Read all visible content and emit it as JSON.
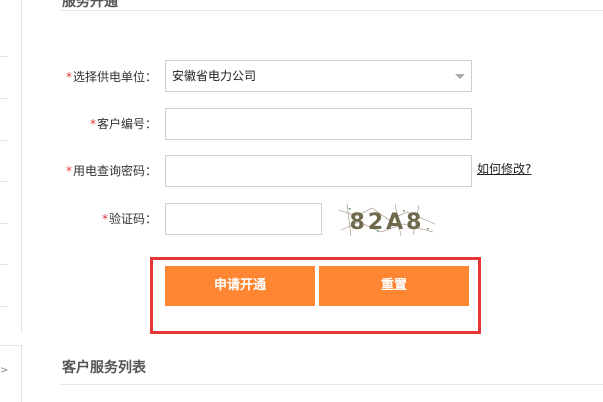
{
  "top_section": {
    "title_fragment": "服务开通"
  },
  "form": {
    "supplier": {
      "label": "选择供电单位：",
      "value": "安徽省电力公司"
    },
    "customer_no": {
      "label": "客户编号：",
      "value": ""
    },
    "query_password": {
      "label": "用电查询密码：",
      "value": "",
      "help_link": "如何修改?"
    },
    "captcha": {
      "label": "验证码：",
      "value": "",
      "image_text": "82A8"
    },
    "required_mark": "*"
  },
  "buttons": {
    "apply": "申请开通",
    "reset": "重置"
  },
  "section": {
    "title": "客户服务列表"
  },
  "sidebar": {
    "arrow": ">"
  },
  "colors": {
    "accent": "#fe8633",
    "highlight": "#e63535",
    "required": "#e23a3a"
  }
}
